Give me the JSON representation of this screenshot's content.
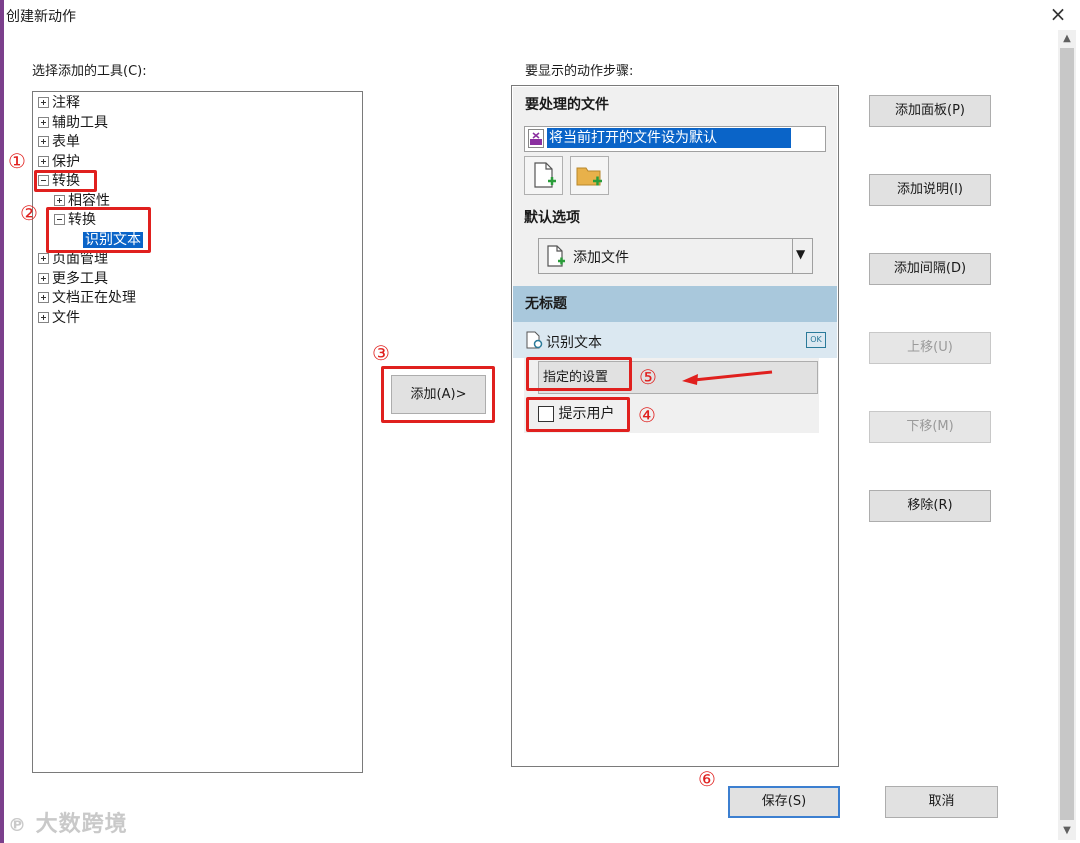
{
  "dialog": {
    "title": "创建新动作",
    "close_label": "×"
  },
  "tools": {
    "label": "选择添加的工具(C):",
    "tree": [
      {
        "label": "注释",
        "expander": "+"
      },
      {
        "label": "辅助工具",
        "expander": "+"
      },
      {
        "label": "表单",
        "expander": "+"
      },
      {
        "label": "保护",
        "expander": "+"
      },
      {
        "label": "转换",
        "expander": "-"
      },
      {
        "label": "相容性",
        "expander": "+"
      },
      {
        "label": "转换",
        "expander": "-"
      },
      {
        "label": "识别文本",
        "selected": true
      },
      {
        "label": "页面管理",
        "expander": "+"
      },
      {
        "label": "更多工具",
        "expander": "+"
      },
      {
        "label": "文档正在处理",
        "expander": "+"
      },
      {
        "label": "文件",
        "expander": "+"
      }
    ]
  },
  "add_button": {
    "label": "添加(A)>"
  },
  "steps": {
    "label": "要显示的动作步骤:",
    "files_header": "要处理的文件",
    "file_entry": "将当前打开的文件设为默认",
    "default_options_label": "默认选项",
    "dropdown_value": "添加文件",
    "untitled_header": "无标题",
    "step_name": "识别文本",
    "ok_badge": "OK",
    "specified_settings": "指定的设置",
    "prompt_user": "提示用户"
  },
  "side_buttons": {
    "add_panel": "添加面板(P)",
    "add_note": "添加说明(I)",
    "add_gap": "添加间隔(D)",
    "move_up": "上移(U)",
    "move_down": "下移(M)",
    "remove": "移除(R)"
  },
  "footer": {
    "save": "保存(S)",
    "cancel": "取消"
  },
  "annotations": {
    "n1": "①",
    "n2": "②",
    "n3": "③",
    "n4": "④",
    "n5": "⑤",
    "n6": "⑥"
  },
  "watermark": "大数跨境",
  "colors": {
    "selection": "#0a64c8",
    "annotation_red": "#e0201e",
    "section_blue": "#a9c8dc"
  }
}
